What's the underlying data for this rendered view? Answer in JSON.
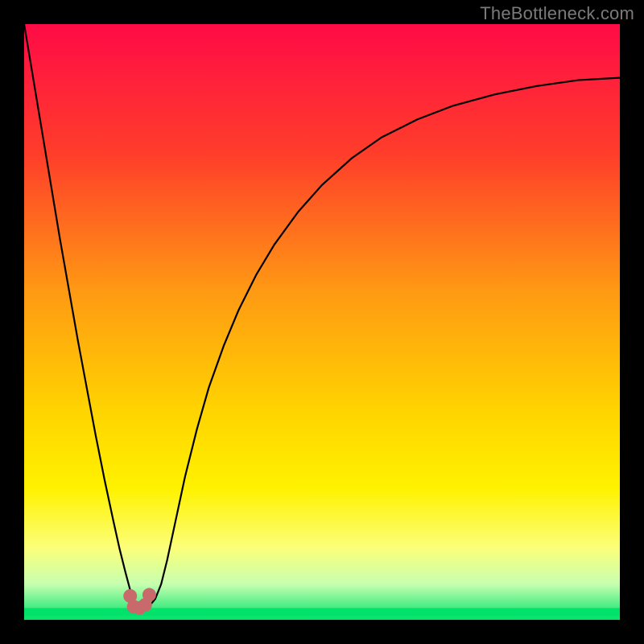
{
  "watermark": {
    "text": "TheBottleneck.com"
  },
  "chart_data": {
    "type": "line",
    "title": "",
    "xlabel": "",
    "ylabel": "",
    "xlim": [
      0,
      100
    ],
    "ylim": [
      0,
      100
    ],
    "background_gradient": {
      "stops": [
        {
          "offset": 0.0,
          "color": "#ff0b46"
        },
        {
          "offset": 0.22,
          "color": "#ff3e2a"
        },
        {
          "offset": 0.45,
          "color": "#ff9a13"
        },
        {
          "offset": 0.65,
          "color": "#ffd400"
        },
        {
          "offset": 0.78,
          "color": "#fff200"
        },
        {
          "offset": 0.88,
          "color": "#fbff7a"
        },
        {
          "offset": 0.94,
          "color": "#c7ffb0"
        },
        {
          "offset": 1.0,
          "color": "#00e26a"
        }
      ]
    },
    "series": [
      {
        "name": "bottleneck-curve",
        "color": "#000000",
        "width": 2.2,
        "x": [
          0.0,
          1.5,
          3.0,
          4.5,
          6.0,
          7.5,
          9.0,
          10.5,
          12.0,
          13.5,
          15.0,
          16.0,
          17.0,
          17.8,
          18.5,
          19.2,
          20.0,
          21.0,
          22.0,
          23.0,
          24.0,
          25.5,
          27.0,
          29.0,
          31.0,
          33.5,
          36.0,
          39.0,
          42.0,
          46.0,
          50.0,
          55.0,
          60.0,
          66.0,
          72.0,
          79.0,
          86.0,
          93.0,
          100.0
        ],
        "y": [
          100.0,
          91.0,
          82.0,
          73.0,
          64.0,
          55.5,
          47.0,
          39.0,
          31.0,
          23.5,
          16.5,
          12.0,
          8.0,
          5.0,
          3.2,
          2.3,
          2.0,
          2.3,
          3.5,
          6.0,
          10.0,
          17.0,
          24.0,
          32.0,
          39.0,
          46.0,
          52.0,
          58.0,
          63.0,
          68.5,
          73.0,
          77.5,
          81.0,
          84.0,
          86.3,
          88.2,
          89.6,
          90.6,
          91.0
        ]
      }
    ],
    "markers": {
      "color": "#c86a6c",
      "radius": 8.5,
      "points": [
        {
          "x": 17.8,
          "y": 4.0
        },
        {
          "x": 18.4,
          "y": 2.2
        },
        {
          "x": 19.4,
          "y": 2.0
        },
        {
          "x": 20.3,
          "y": 2.5
        },
        {
          "x": 21.0,
          "y": 4.2
        }
      ]
    },
    "baseline": {
      "y": 1.3,
      "color": "#00e26a",
      "width": 10
    }
  }
}
